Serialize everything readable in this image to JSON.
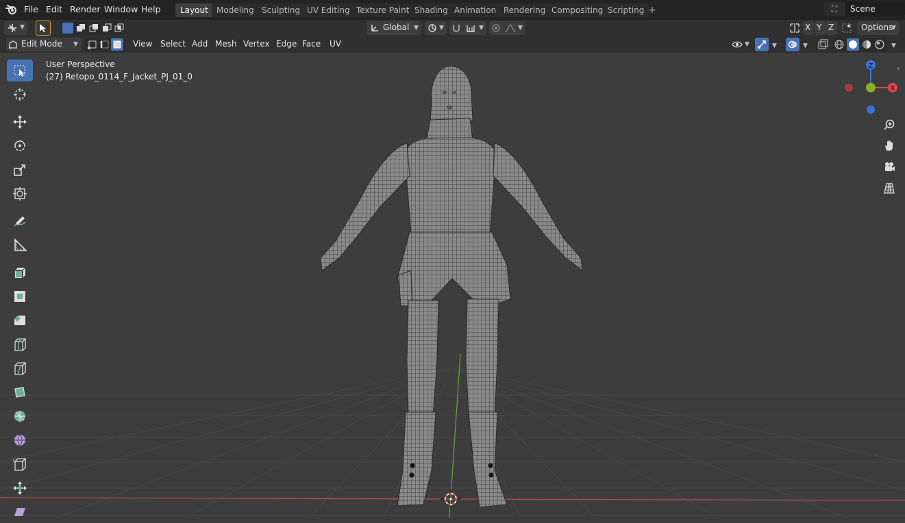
{
  "menu": {
    "items": [
      "File",
      "Edit",
      "Render",
      "Window",
      "Help"
    ]
  },
  "workspaces": {
    "tabs": [
      "Layout",
      "Modeling",
      "Sculpting",
      "UV Editing",
      "Texture Paint",
      "Shading",
      "Animation",
      "Rendering",
      "Compositing",
      "Scripting"
    ],
    "active": "Layout",
    "add_label": "+"
  },
  "scene": {
    "name": "Scene"
  },
  "tool_header": {
    "transform_orientation": "Global",
    "axis_x": "X",
    "axis_y": "Y",
    "axis_z": "Z",
    "options_label": "Options"
  },
  "viewport_header": {
    "mode": "Edit Mode",
    "menus": [
      "View",
      "Select",
      "Add",
      "Mesh",
      "Vertex",
      "Edge",
      "Face",
      "UV"
    ]
  },
  "viewport": {
    "title": "User Perspective",
    "object": "(27) Retopo_0114_F_Jacket_PJ_01_0"
  },
  "gizmo": {
    "x_label": "X",
    "z_label": "Z"
  },
  "colors": {
    "accent": "#4772b3",
    "axis_x": "#e04350",
    "axis_y": "#86b227",
    "axis_z": "#3874d8",
    "grid_red_line": "#b84a4a",
    "grid_green_line": "#6a9a3a"
  }
}
